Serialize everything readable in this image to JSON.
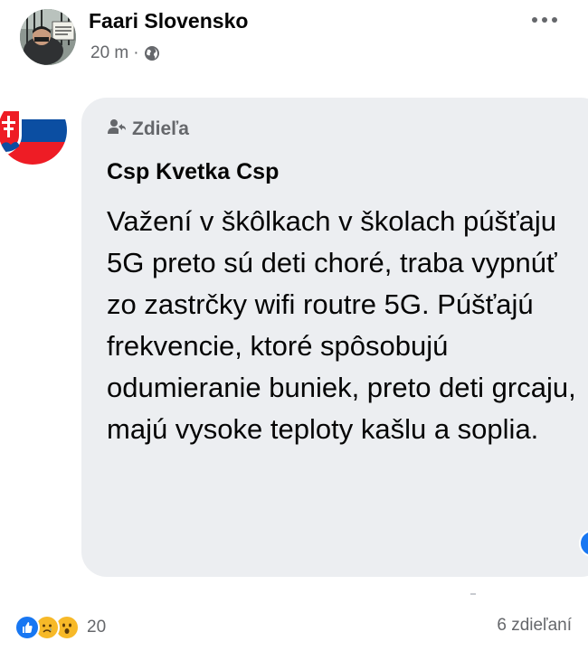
{
  "post": {
    "author": "Faari Slovensko",
    "time": "20 m",
    "separator": "·",
    "privacy_icon": "globe-icon",
    "more_icon": "more-horizontal-icon",
    "avatar_sign_text": "Prečo si zaočkovaný?"
  },
  "shared_post": {
    "label": "Zdieľa",
    "label_icon": "share-person-icon",
    "author": "Csp Kvetka Csp",
    "avatar_icon": "slovak-flag-avatar",
    "text": "Važení v škôlkach v školach púšťaju 5G preto sú deti choré, traba vypnúť zo zastrčky wifi routre 5G. Púšťajú frekvencie, ktoré spôsobujú odumieranie buniek, preto deti grcaju, majú vysoke teploty kašlu a soplia."
  },
  "footer": {
    "reaction_icons": [
      "like-icon",
      "sad-icon",
      "wow-icon"
    ],
    "reaction_count": "20",
    "shares": "6 zdieľaní"
  },
  "colors": {
    "bubble": "#eceef1",
    "secondary_text": "#65676b",
    "like_blue": "#1877f2",
    "reaction_yellow": "#f7b928"
  }
}
